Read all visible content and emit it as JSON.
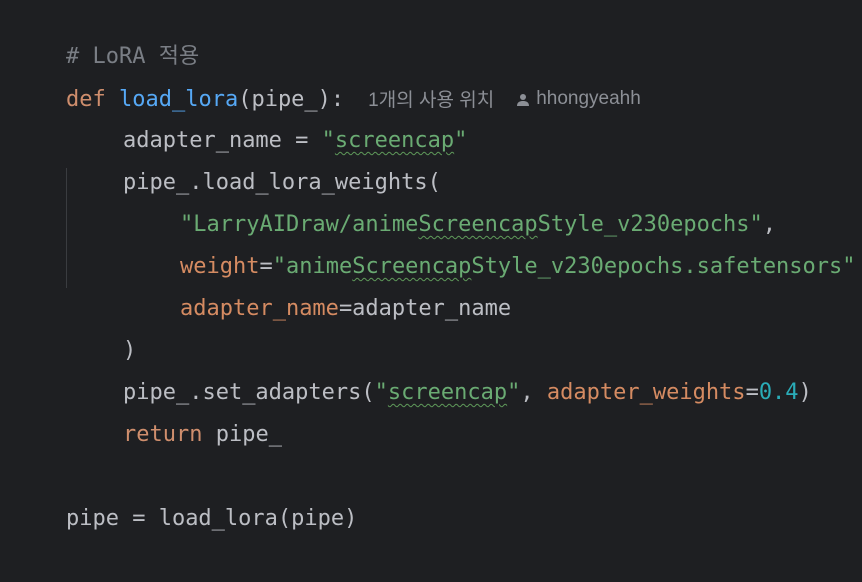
{
  "editor": {
    "line1": {
      "comment": "# LoRA 적용"
    },
    "line2": {
      "kw_def": "def",
      "fn_name": "load_lora",
      "params": "(pipe_):",
      "usages": "1개의 사용 위치",
      "author": "hhongyeahh",
      "author_icon": "person-icon"
    },
    "line3": {
      "lhs": "adapter_name = ",
      "q1": "\"",
      "str": "screencap",
      "q2": "\""
    },
    "line4": {
      "code": "pipe_.load_lora_weights("
    },
    "line5": {
      "q1": "\"LarryAIDraw/anime",
      "str": "Screencap",
      "rest": "Style_v230epochs\"",
      "comma": ","
    },
    "line6": {
      "param": "weight",
      "eq": "=",
      "q1": "\"anime",
      "str": "Screencap",
      "rest": "Style_v230epochs.safetensors\""
    },
    "line7": {
      "param": "adapter_name",
      "rest": "=adapter_name"
    },
    "line8": {
      "code": ")"
    },
    "line9": {
      "pre": "pipe_.set_adapters(",
      "q1": "\"",
      "str": "screencap",
      "q2": "\"",
      "sep": ", ",
      "param": "adapter_weights",
      "eq": "=",
      "num": "0.4",
      "close": ")"
    },
    "line10": {
      "kw": "return",
      "rest": " pipe_"
    },
    "line12": {
      "code": "pipe = load_lora(pipe)"
    }
  }
}
